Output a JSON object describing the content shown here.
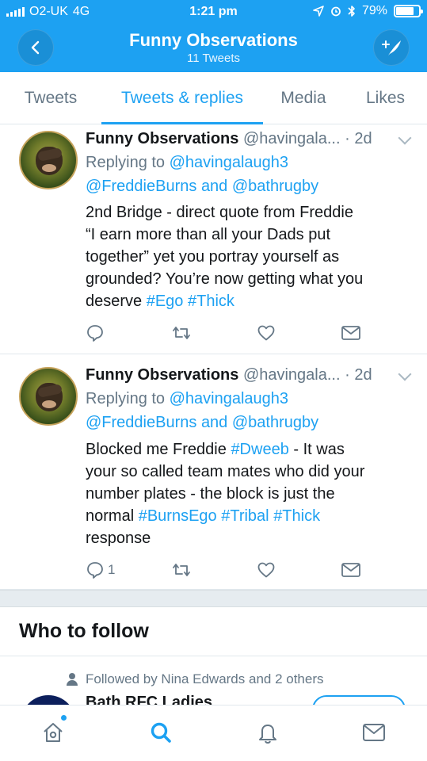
{
  "status_bar": {
    "carrier": "O2-UK",
    "network": "4G",
    "time": "1:21 pm",
    "battery_percent": "79%",
    "battery_level": 0.79
  },
  "header": {
    "title": "Funny Observations",
    "subtitle": "11 Tweets",
    "back_icon": "chevron-left-icon",
    "compose_icon": "compose-tweet-icon"
  },
  "tabs": [
    {
      "label": "Tweets",
      "active": false
    },
    {
      "label": "Tweets & replies",
      "active": true
    },
    {
      "label": "Media",
      "active": false
    },
    {
      "label": "Likes",
      "active": false
    }
  ],
  "tweets": [
    {
      "name": "Funny Observations",
      "handle": "@havingala...",
      "time": "· 2d",
      "replying_prefix": "Replying to",
      "reply_to_1": "@havingalaugh3",
      "reply_to_2": "@FreddieBurns",
      "reply_and": "and",
      "reply_to_3": "@bathrugby",
      "body_line_1": "2nd Bridge - direct quote from Freddie",
      "body_line_2": "“I earn more than all your Dads put",
      "body_line_3": "together” yet you portray yourself as",
      "body_line_4": "grounded? You’re now getting what you",
      "body_line_5_text": "deserve",
      "hashtag_1": "#Ego",
      "hashtag_2": "#Thick",
      "reply_count": ""
    },
    {
      "name": "Funny Observations",
      "handle": "@havingala...",
      "time": "· 2d",
      "replying_prefix": "Replying to",
      "reply_to_1": "@havingalaugh3",
      "reply_to_2": "@FreddieBurns",
      "reply_and": "and",
      "reply_to_3": "@bathrugby",
      "body_line_1_text": "Blocked me Freddie",
      "hashtag_1": "#Dweeb",
      "body_line_1_tail": "- It was",
      "body_line_2": "your so called team mates who did your",
      "body_line_3": "number plates - the block is just the",
      "body_line_4_text": "normal",
      "hashtag_2": "#BurnsEgo",
      "hashtag_3": "#Tribal",
      "hashtag_4": "#Thick",
      "body_line_5": "response",
      "reply_count": "1"
    }
  ],
  "who_to_follow": {
    "title": "Who to follow",
    "followed_by": "Followed by Nina Edwards and 2 others",
    "suggested_name": "Bath RFC Ladies"
  },
  "bottom_nav": [
    {
      "icon": "home-icon"
    },
    {
      "icon": "search-icon"
    },
    {
      "icon": "bell-icon"
    },
    {
      "icon": "mail-icon"
    }
  ],
  "colors": {
    "brand": "#1da1f2",
    "text": "#14171a",
    "secondary": "#657786",
    "divider": "#e1e8ed"
  }
}
